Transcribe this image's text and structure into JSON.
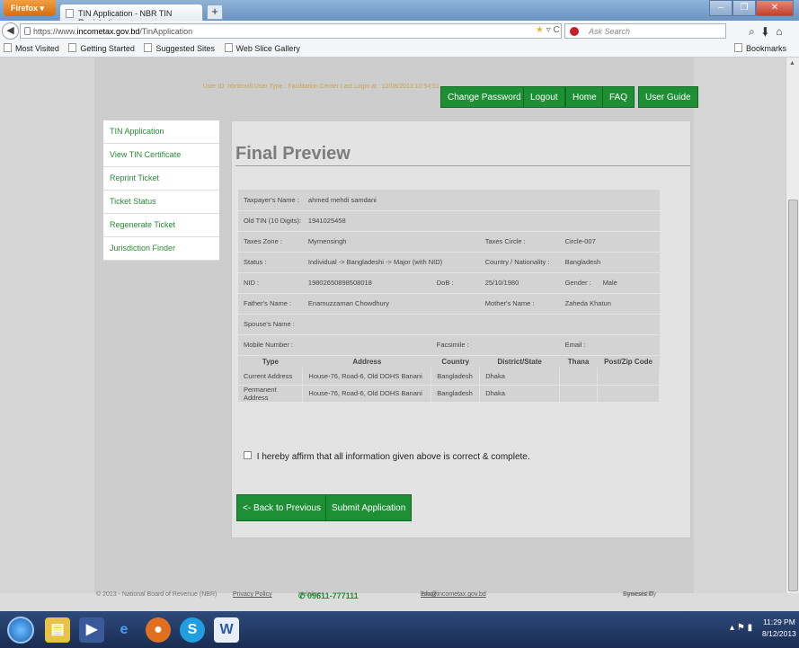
{
  "browser": {
    "app_button": "Firefox",
    "tab_title": "TIN Application - NBR TIN Registration",
    "new_tab": "+",
    "url_prefix": "https://www.",
    "url_host": "incometax.gov.bd",
    "url_path": "/TinApplication",
    "search_placeholder": "Ask Search",
    "bookmarks": [
      "Most Visited",
      "Getting Started",
      "Suggested Sites",
      "Web Slice Gallery"
    ],
    "bookmarks_menu": "Bookmarks"
  },
  "header": {
    "user_info": "User ID: nbrtinxxll User Type : Facilitation Center Last Login at : 12/08/2013 10:54:51",
    "buttons": [
      "Change Password",
      "Logout",
      "Home",
      "FAQ",
      "User Guide"
    ]
  },
  "sidebar": {
    "items": [
      "TIN Application",
      "View TIN Certificate",
      "Reprint Ticket",
      "Ticket Status",
      "Regenerate Ticket",
      "Jurisdiction Finder"
    ]
  },
  "page": {
    "title": "Final Preview"
  },
  "preview": {
    "taxpayer_name_label": "Taxpayer's Name :",
    "taxpayer_name": "ahmed mehdi samdani",
    "old_tin_label": "Old TIN (10 Digits):",
    "old_tin": "1941025458",
    "taxes_zone_label": "Taxes Zone :",
    "taxes_zone": "Mymensingh",
    "taxes_circle_label": "Taxes Circle :",
    "taxes_circle": "Circle-007",
    "status_label": "Status :",
    "status": "Individual -> Bangladeshi -> Major (with NID)",
    "country_label": "Country / Nationality :",
    "country": "Bangladesh",
    "nid_label": "NID :",
    "nid": "19802650898508018",
    "dob_label": "DoB :",
    "dob": "25/10/1980",
    "gender_label": "Gender :",
    "gender": "Male",
    "father_label": "Father's Name :",
    "father": "Enamuzzaman Chowdhury",
    "mother_label": "Mother's Name :",
    "mother": "Zaheda Khatun",
    "spouse_label": "Spouse's Name :",
    "mobile_label": "Mobile Number :",
    "facsimile_label": "Facsimile :",
    "email_label": "Email :",
    "address_headers": [
      "Type",
      "Address",
      "Country",
      "District/State",
      "Thana",
      "Post/Zip Code"
    ],
    "addresses": [
      {
        "type": "Current Address",
        "address": "House-76, Road-6, Old DOHS Banani",
        "country": "Bangladesh",
        "district": "Dhaka"
      },
      {
        "type": "Permanent Address",
        "address": "House-76, Road-6, Old DOHS Banani",
        "country": "Bangladesh",
        "district": "Dhaka"
      }
    ]
  },
  "form": {
    "affirm_text": "I hereby affirm that all information given above is correct & complete.",
    "back_button": "<- Back to Previous",
    "submit_button": "Submit Application"
  },
  "footer": {
    "copyright": "© 2013 - National Board of Revenue (NBR)",
    "privacy": "Privacy Policy",
    "helpline_label": "Helpline:",
    "helpline": "✆ 09611-777111",
    "email_label": "Email:",
    "email": "info@incometax.gov.bd",
    "powered_by": "Powered by",
    "powered_brand": "Synesis IT"
  },
  "taskbar": {
    "time": "11:29 PM",
    "date": "8/12/2013"
  },
  "colors": {
    "accent_green": "#1e8f34",
    "sidebar_text": "#2a8a3a"
  }
}
